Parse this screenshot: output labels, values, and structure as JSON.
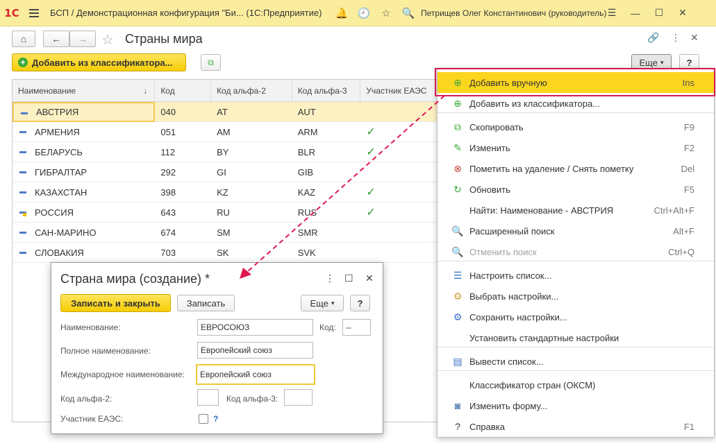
{
  "titlebar": {
    "logo": "1С",
    "title": "БСП / Демонстрационная конфигурация \"Би... (1С:Предприятие)",
    "user": "Петрищев Олег Константинович (руководитель)"
  },
  "form": {
    "title": "Страны мира",
    "add_from_classifier": "Добавить из классификатора...",
    "more": "Еще",
    "help": "?"
  },
  "table": {
    "columns": [
      "Наименование",
      "Код",
      "Код альфа-2",
      "Код альфа-3",
      "Участник ЕАЭС"
    ],
    "rows": [
      {
        "name": "АВСТРИЯ",
        "code": "040",
        "a2": "AT",
        "a3": "AUT",
        "eaeu": false
      },
      {
        "name": "АРМЕНИЯ",
        "code": "051",
        "a2": "AM",
        "a3": "ARM",
        "eaeu": true
      },
      {
        "name": "БЕЛАРУСЬ",
        "code": "112",
        "a2": "BY",
        "a3": "BLR",
        "eaeu": true
      },
      {
        "name": "ГИБРАЛТАР",
        "code": "292",
        "a2": "GI",
        "a3": "GIB",
        "eaeu": false
      },
      {
        "name": "КАЗАХСТАН",
        "code": "398",
        "a2": "KZ",
        "a3": "KAZ",
        "eaeu": true
      },
      {
        "name": "РОССИЯ",
        "code": "643",
        "a2": "RU",
        "a3": "RUS",
        "eaeu": true
      },
      {
        "name": "САН-МАРИНО",
        "code": "674",
        "a2": "SM",
        "a3": "SMR",
        "eaeu": false
      },
      {
        "name": "СЛОВАКИЯ",
        "code": "703",
        "a2": "SK",
        "a3": "SVK",
        "eaeu": false
      }
    ]
  },
  "menu": {
    "items": [
      {
        "label": "Добавить вручную",
        "shortcut": "Ins"
      },
      {
        "label": "Добавить из классификатора...",
        "shortcut": ""
      },
      {
        "label": "Скопировать",
        "shortcut": "F9"
      },
      {
        "label": "Изменить",
        "shortcut": "F2"
      },
      {
        "label": "Пометить на удаление / Снять пометку",
        "shortcut": "Del"
      },
      {
        "label": "Обновить",
        "shortcut": "F5"
      },
      {
        "label": "Найти: Наименование - АВСТРИЯ",
        "shortcut": "Ctrl+Alt+F"
      },
      {
        "label": "Расширенный поиск",
        "shortcut": "Alt+F"
      },
      {
        "label": "Отменить поиск",
        "shortcut": "Ctrl+Q"
      },
      {
        "label": "Настроить список...",
        "shortcut": ""
      },
      {
        "label": "Выбрать настройки...",
        "shortcut": ""
      },
      {
        "label": "Сохранить настройки...",
        "shortcut": ""
      },
      {
        "label": "Установить стандартные настройки",
        "shortcut": ""
      },
      {
        "label": "Вывести список...",
        "shortcut": ""
      },
      {
        "label": "Классификатор стран (ОКСМ)",
        "shortcut": ""
      },
      {
        "label": "Изменить форму...",
        "shortcut": ""
      },
      {
        "label": "Справка",
        "shortcut": "F1"
      }
    ]
  },
  "dialog": {
    "title": "Страна мира (создание) *",
    "save_close": "Записать и закрыть",
    "save": "Записать",
    "more": "Еще",
    "help": "?",
    "name_label": "Наименование:",
    "name_value": "ЕВРОСОЮЗ",
    "code_label": "Код:",
    "code_value": "--",
    "full_name_label": "Полное наименование:",
    "full_name_value": "Европейский союз",
    "intl_name_label": "Международное наименование:",
    "intl_name_value": "Европейский союз",
    "alpha2_label": "Код альфа-2:",
    "alpha3_label": "Код альфа-3:",
    "eaeu_label": "Участник ЕАЭС:",
    "eaeu_help": "?"
  },
  "colors": {
    "titlebar_bg": "#fbed9e",
    "accent_yellow": "#f5cd05",
    "highlight_frame": "#d6184b",
    "check_green": "#2d9a2d"
  }
}
